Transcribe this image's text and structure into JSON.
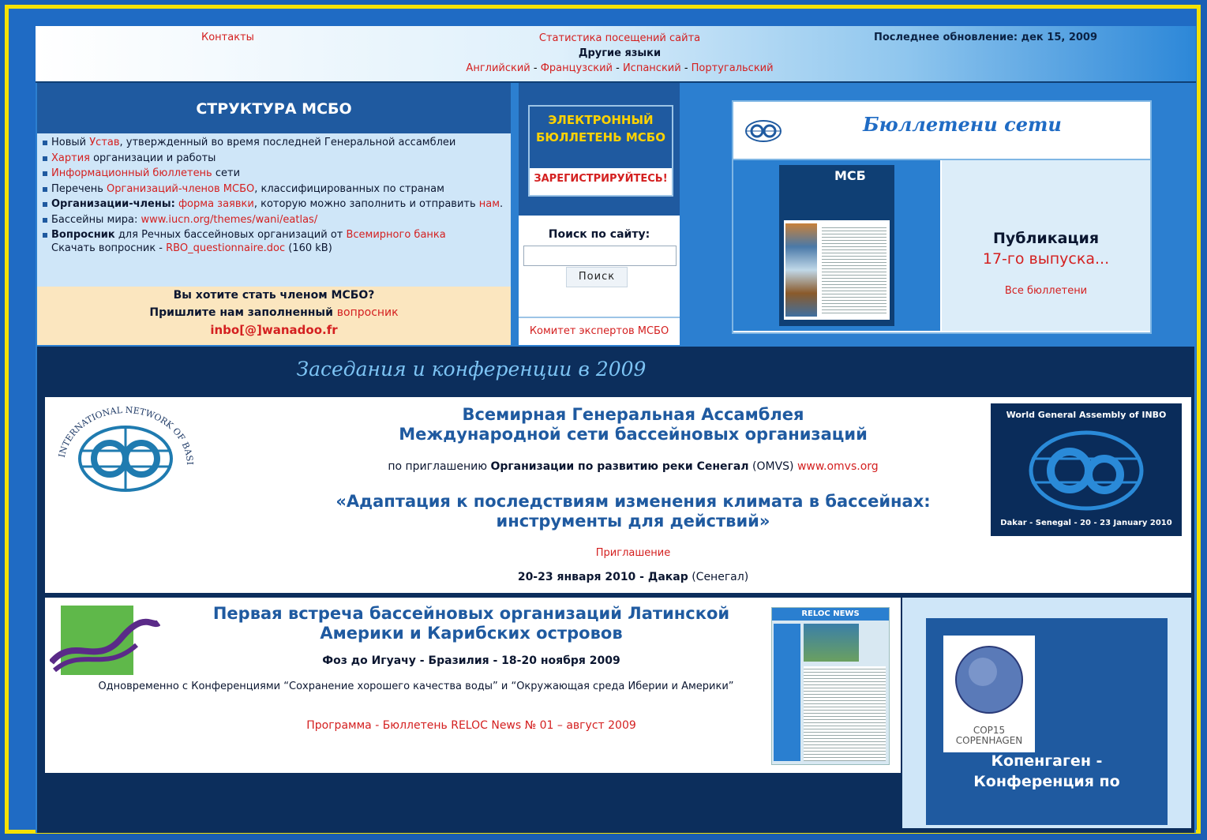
{
  "header": {
    "contacts": "Контакты",
    "stats": "Статистика посещений сайта",
    "other_languages": "Другие языки",
    "lang_en": "Английский",
    "lang_fr": "Французский",
    "lang_es": "Испанский",
    "lang_pt": "Португальский",
    "last_update": "Последнее обновление: дек 15, 2009"
  },
  "structure": {
    "title": "СТРУКТУРА МСБО",
    "item1_a": "Новый ",
    "item1_link": "Устав",
    "item1_b": ", утвержденный во время последней Генеральной ассамблеи",
    "item2_link": "Хартия",
    "item2_b": " организации и работы",
    "item3_link": "Информационный бюллетень",
    "item3_b": " сети",
    "item4_a": "Перечень ",
    "item4_link": "Организаций-членов МСБО",
    "item4_b": ", классифицированных по странам",
    "item5_a": "Организации-члены:",
    "item5_link": "форма заявки",
    "item5_b": ", которую можно заполнить и отправить ",
    "item5_link2": "нам",
    "item6_a": "Бассейны мира: ",
    "item6_link": "www.iucn.org/themes/wani/eatlas/",
    "item7_a": "Вопросник",
    "item7_b": " для Речных бассейновых организаций от ",
    "item7_link": "Всемирного банка",
    "item7_c": "Скачать вопросник - ",
    "item7_link2": "RBO_questionnaire.doc",
    "item7_d": " (160 kB)",
    "join_q": "Вы хотите стать членом МСБО?",
    "join_send": "Пришлите нам заполненный ",
    "join_link": "вопросник",
    "email": "inbo[@]wanadoo.fr"
  },
  "bulletin": {
    "title": "ЭЛЕКТРОННЫЙ БЮЛЛЕТЕНЬ МСБО",
    "register": "ЗАРЕГИСТРИРУЙТЕСЬ!",
    "search_label": "Поиск по сайту:",
    "search_button": "Поиск",
    "experts": "Комитет экспертов МСБО"
  },
  "network": {
    "title": "Бюллетени сети",
    "cover_title": "МСБ",
    "pub1": "Публикация",
    "pub2": "17-го выпуска...",
    "all": "Все бюллетени"
  },
  "conferences": {
    "title": "Заседания и конференции в 2009",
    "wga_h1": "Всемирная Генеральная Ассамблея",
    "wga_h2": "Международной сети бассейновых организаций",
    "wga_inv_a": "по приглашению ",
    "wga_inv_b": "Организации по развитию реки Сенегал",
    "wga_inv_c": " (OMVS) ",
    "wga_inv_link": "www.omvs.org",
    "wga_q1": "«Адаптация к последствиям изменения климата в бассейнах:",
    "wga_q2": "инструменты для действий»",
    "wga_invitation": "Приглашение",
    "wga_date_a": "20-23 января 2010 - Дакар",
    "wga_date_b": " (Сенегал)",
    "logo_text": "INTERNATIONAL NETWORK OF BASIN ORGANIZATIONS",
    "badge_top": "World General Assembly of INBO",
    "badge_bottom": "Dakar - Senegal - 20 - 23 January 2010",
    "lat_h1": "Первая встреча бассейновых организаций Латинской",
    "lat_h2": "Америки и Карибских островов",
    "lat_date": "Фоз до Игуачу - Бразилия - 18-20 ноября 2009",
    "lat_sub": "Одновременно с Конференциями “Сохранение хорошего качества воды” и “Окружающая среда Иберии и Америки”",
    "lat_prog": "Программа",
    "lat_news": "Бюллетень RELOC News № 01 – август 2009",
    "reloc_title": "RELOC NEWS",
    "cop_cap": "COP15 COPENHAGEN",
    "cop_t1": "Копенгаген -",
    "cop_t2": "Конференция по"
  },
  "colors": {
    "accent_red": "#d42020",
    "brand_blue": "#1f5aa0",
    "frame_yellow": "#f5e100",
    "dark_navy": "#0c2e5c"
  }
}
